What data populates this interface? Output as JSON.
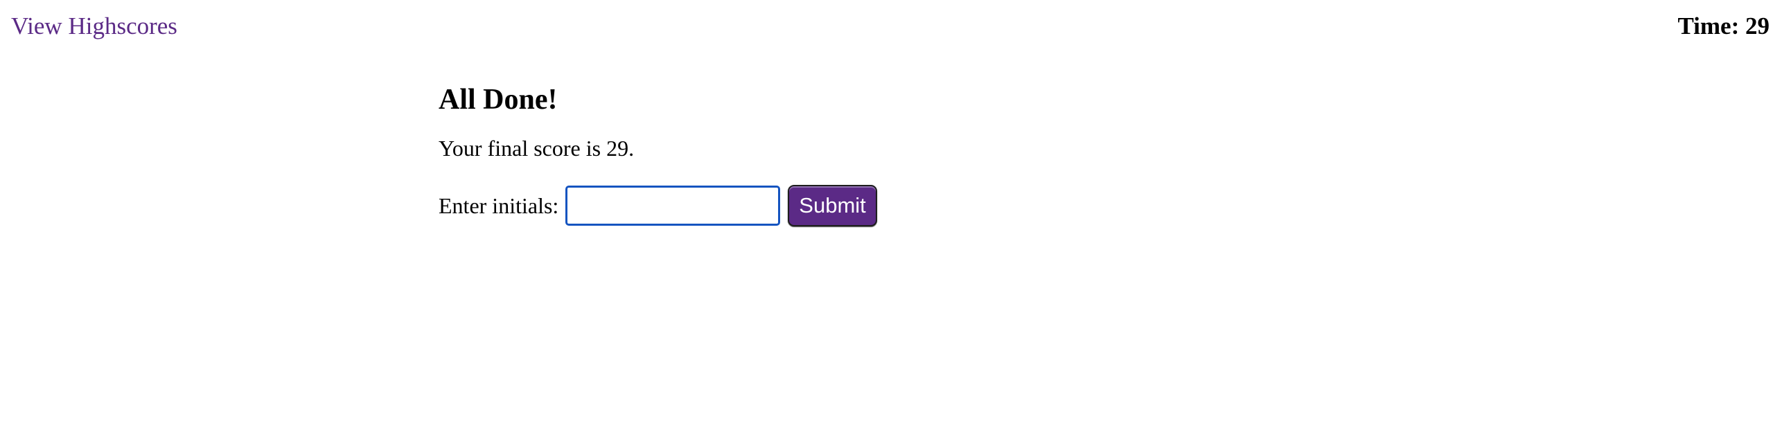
{
  "header": {
    "highscores_link": "View Highscores",
    "timer_label": "Time: ",
    "timer_value": "29"
  },
  "main": {
    "title": "All Done!",
    "score_prefix": "Your final score is ",
    "score_value": "29",
    "score_suffix": ".",
    "initials_label": "Enter initials:",
    "initials_value": "",
    "submit_label": "Submit"
  },
  "colors": {
    "link": "#5b2a86",
    "button_bg": "#5b2a86",
    "input_focus_border": "#1554c0"
  }
}
